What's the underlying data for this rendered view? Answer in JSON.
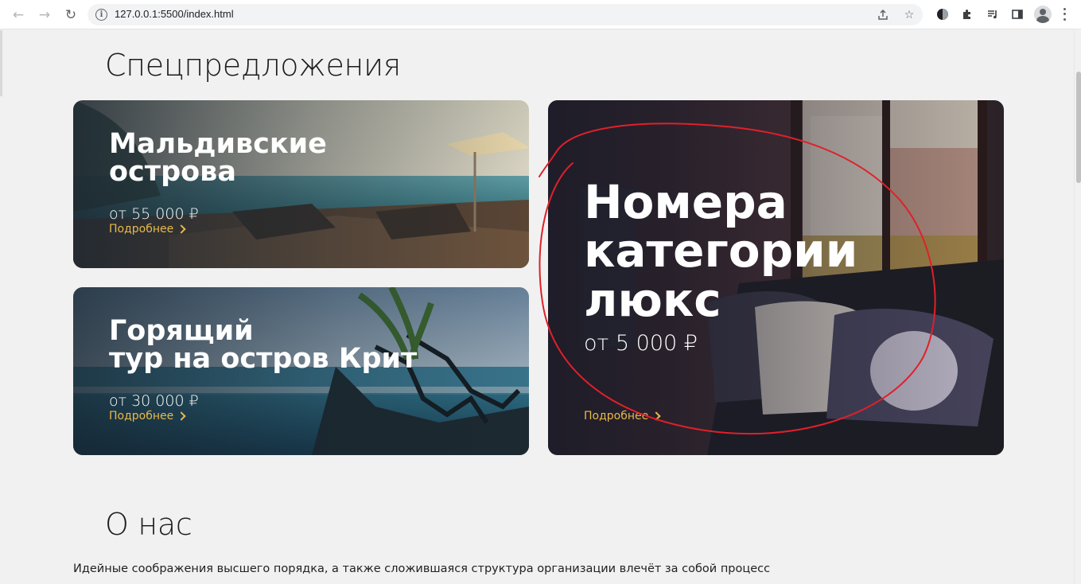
{
  "browser": {
    "url": "127.0.0.1:5500/index.html",
    "icons": {
      "back": "back-arrow-icon",
      "forward": "forward-arrow-icon",
      "reload": "reload-icon",
      "info": "info-icon",
      "share": "share-icon",
      "bookmark": "star-icon",
      "extension_1": "theme-extension-icon",
      "extensions": "puzzle-icon",
      "media": "media-queue-icon",
      "side_panel": "side-panel-icon",
      "profile": "profile-avatar-icon",
      "menu": "kebab-menu-icon"
    }
  },
  "specials": {
    "title": "Спецпредложения",
    "cards": [
      {
        "title_line1": "Мальдивские",
        "title_line2": "острова",
        "price": "от 55 000 ₽",
        "link": "Подробнее"
      },
      {
        "title_line1": "Горящий",
        "title_line2": "тур на остров Крит",
        "price": "от 30 000 ₽",
        "link": "Подробнее"
      },
      {
        "title_line1": "Номера",
        "title_line2": "категории",
        "title_line3": "люкс",
        "price": "от 5 000 ₽",
        "link": "Подробнее"
      }
    ]
  },
  "about": {
    "title": "О нас",
    "text": "Идейные соображения высшего порядка, а также сложившаяся структура организации влечёт за собой процесс"
  },
  "colors": {
    "page_bg": "#f1f1f1",
    "link_accent": "#e8b94a",
    "annotation_red": "#e0202a"
  }
}
